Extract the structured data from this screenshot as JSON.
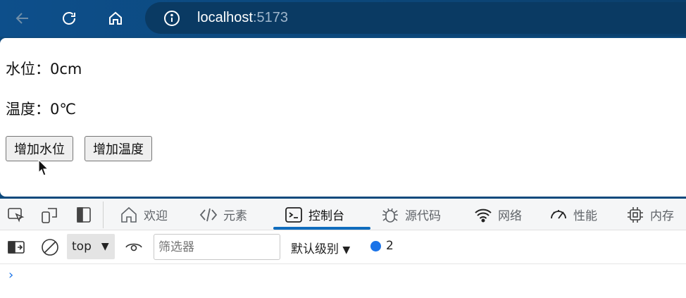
{
  "browser": {
    "url_host": "localhost",
    "url_port": ":5173"
  },
  "page": {
    "water_level": "水位：0cm",
    "temperature": "温度：0℃",
    "add_water_label": "增加水位",
    "add_temp_label": "增加温度"
  },
  "devtools": {
    "tabs": [
      {
        "label": "欢迎",
        "icon": "home-icon"
      },
      {
        "label": "元素",
        "icon": "code-icon"
      },
      {
        "label": "控制台",
        "icon": "console-icon",
        "active": true
      },
      {
        "label": "源代码",
        "icon": "bug-icon"
      },
      {
        "label": "网络",
        "icon": "wifi-icon"
      },
      {
        "label": "性能",
        "icon": "gauge-icon"
      },
      {
        "label": "内存",
        "icon": "chip-icon"
      }
    ],
    "context": "top",
    "filter_placeholder": "筛选器",
    "level": "默认级别",
    "issues_count": "2",
    "prompt": "›"
  },
  "colors": {
    "accent": "#0f6cbd",
    "topbar": "#0d4f8b"
  }
}
